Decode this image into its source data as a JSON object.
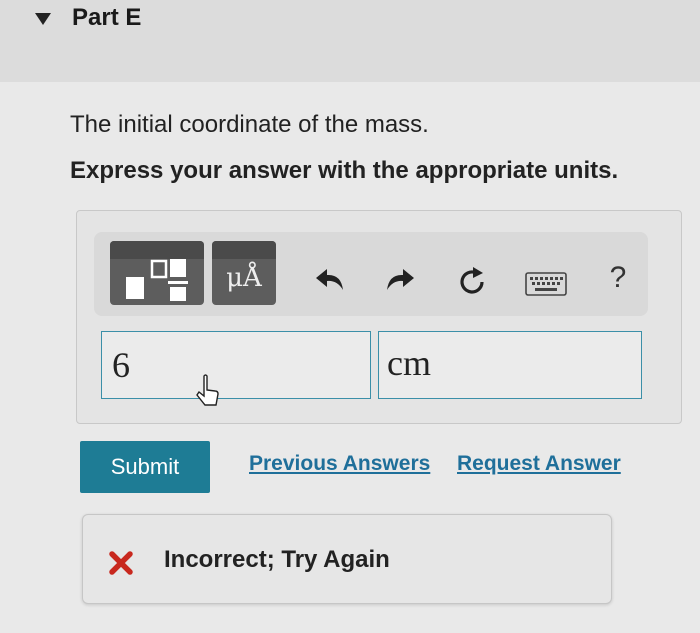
{
  "part": {
    "title": "Part E",
    "collapse_icon": "triangle-down-icon"
  },
  "question": {
    "text": "The initial coordinate of the mass.",
    "instruction": "Express your answer with the appropriate units."
  },
  "toolbar": {
    "buttons": [
      {
        "name": "templates-button",
        "icon": "templates-icon"
      },
      {
        "name": "units-button",
        "icon": "units-icon",
        "label": "μÅ"
      },
      {
        "name": "undo-button",
        "icon": "undo-icon"
      },
      {
        "name": "redo-button",
        "icon": "redo-icon"
      },
      {
        "name": "reset-button",
        "icon": "reset-icon"
      },
      {
        "name": "keyboard-button",
        "icon": "keyboard-icon"
      },
      {
        "name": "help-button",
        "icon": "help-icon",
        "label": "?"
      }
    ]
  },
  "answer": {
    "value": "6",
    "units": "cm"
  },
  "actions": {
    "submit_label": "Submit",
    "previous_answers_label": "Previous Answers",
    "request_answer_label": "Request Answer"
  },
  "feedback": {
    "icon": "red-x-icon",
    "text": "Incorrect; Try Again"
  },
  "colors": {
    "submit_bg": "#1e7c95",
    "link": "#1f6f9a",
    "input_border": "#3b8fa8",
    "error_x": "#c8281e"
  }
}
